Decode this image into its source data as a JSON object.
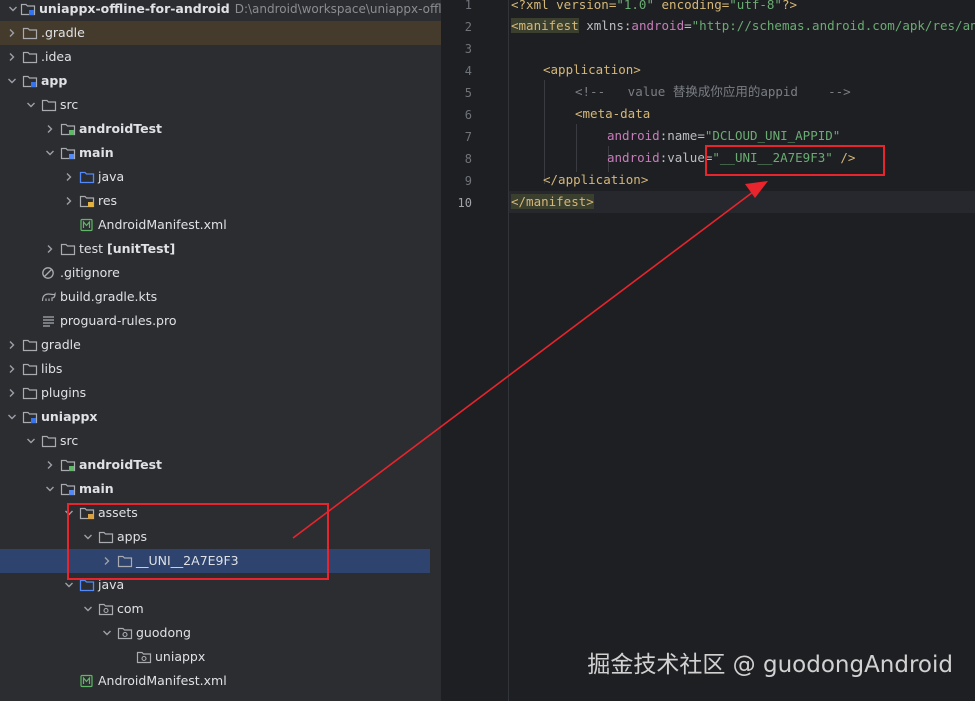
{
  "project_tree": {
    "root_name": "uniappx-offline-for-android",
    "root_path": "D:\\android\\workspace\\uniappx-offline",
    "items": [
      {
        "label": ".gradle",
        "depth": 1,
        "chevron": "right",
        "icon": "folder-icon",
        "highlight": "orange"
      },
      {
        "label": ".idea",
        "depth": 1,
        "chevron": "right",
        "icon": "folder-icon"
      },
      {
        "label": "app",
        "depth": 1,
        "chevron": "down",
        "icon": "module-folder-icon",
        "bold": true
      },
      {
        "label": "src",
        "depth": 2,
        "chevron": "down",
        "icon": "folder-icon"
      },
      {
        "label": "androidTest",
        "depth": 3,
        "chevron": "right",
        "icon": "test-folder-icon",
        "bold": true
      },
      {
        "label": "main",
        "depth": 3,
        "chevron": "down",
        "icon": "source-set-folder-icon",
        "bold": true
      },
      {
        "label": "java",
        "depth": 4,
        "chevron": "right",
        "icon": "source-folder-icon"
      },
      {
        "label": "res",
        "depth": 4,
        "chevron": "right",
        "icon": "resources-folder-icon"
      },
      {
        "label": "AndroidManifest.xml",
        "depth": 4,
        "chevron": "none",
        "icon": "manifest-file-icon"
      },
      {
        "label": "test",
        "suffix": "[unitTest]",
        "depth": 3,
        "chevron": "right",
        "icon": "folder-icon"
      },
      {
        "label": ".gitignore",
        "depth": 2,
        "chevron": "none",
        "icon": "gitignore-file-icon"
      },
      {
        "label": "build.gradle.kts",
        "depth": 2,
        "chevron": "none",
        "icon": "gradle-file-icon"
      },
      {
        "label": "proguard-rules.pro",
        "depth": 2,
        "chevron": "none",
        "icon": "text-file-icon"
      },
      {
        "label": "gradle",
        "depth": 1,
        "chevron": "right",
        "icon": "folder-icon"
      },
      {
        "label": "libs",
        "depth": 1,
        "chevron": "right",
        "icon": "folder-icon"
      },
      {
        "label": "plugins",
        "depth": 1,
        "chevron": "right",
        "icon": "folder-icon"
      },
      {
        "label": "uniappx",
        "depth": 1,
        "chevron": "down",
        "icon": "module-folder-icon",
        "bold": true
      },
      {
        "label": "src",
        "depth": 2,
        "chevron": "down",
        "icon": "folder-icon"
      },
      {
        "label": "androidTest",
        "depth": 3,
        "chevron": "right",
        "icon": "test-folder-icon",
        "bold": true
      },
      {
        "label": "main",
        "depth": 3,
        "chevron": "down",
        "icon": "source-set-folder-icon",
        "bold": true
      },
      {
        "label": "assets",
        "depth": 4,
        "chevron": "down",
        "icon": "assets-folder-icon"
      },
      {
        "label": "apps",
        "depth": 5,
        "chevron": "down",
        "icon": "folder-icon"
      },
      {
        "label": "__UNI__2A7E9F3",
        "depth": 6,
        "chevron": "right",
        "icon": "folder-icon",
        "selected": true
      },
      {
        "label": "java",
        "depth": 4,
        "chevron": "down",
        "icon": "source-folder-icon"
      },
      {
        "label": "com",
        "depth": 5,
        "chevron": "down",
        "icon": "package-icon"
      },
      {
        "label": "guodong",
        "depth": 6,
        "chevron": "down",
        "icon": "package-icon"
      },
      {
        "label": "uniappx",
        "depth": 7,
        "chevron": "none",
        "icon": "package-icon"
      },
      {
        "label": "AndroidManifest.xml",
        "depth": 4,
        "chevron": "none",
        "icon": "manifest-file-icon"
      }
    ]
  },
  "editor": {
    "line_numbers": [
      "1",
      "2",
      "3",
      "4",
      "5",
      "6",
      "7",
      "8",
      "9",
      "10"
    ],
    "current_line": "10",
    "lines": {
      "l1": {
        "a": "<?xml version=",
        "b": "\"1.0\"",
        "c": " encoding=",
        "d": "\"utf-8\"",
        "e": "?>"
      },
      "l2": {
        "a": "<manifest",
        "b": " xmlns:",
        "c": "android",
        "d": "=",
        "e": "\"http://schemas.android.com/apk/res/android\""
      },
      "l4": {
        "a": "<application>"
      },
      "l5": {
        "a": "<!--   value 替换成你应用的appid    -->"
      },
      "l6": {
        "a": "<meta-data"
      },
      "l7": {
        "a": "android",
        "b": ":name=",
        "c": "\"DCLOUD_UNI_APPID\""
      },
      "l8": {
        "a": "android",
        "b": ":value=",
        "c": "\"__UNI__2A7E9F3\"",
        "d": " />"
      },
      "l9": {
        "a": "</application>"
      },
      "l10": {
        "a": "</manifest>"
      }
    }
  },
  "annotation": {
    "color": "#e8242c"
  },
  "watermark": "掘金技术社区 @ guodongAndroid"
}
